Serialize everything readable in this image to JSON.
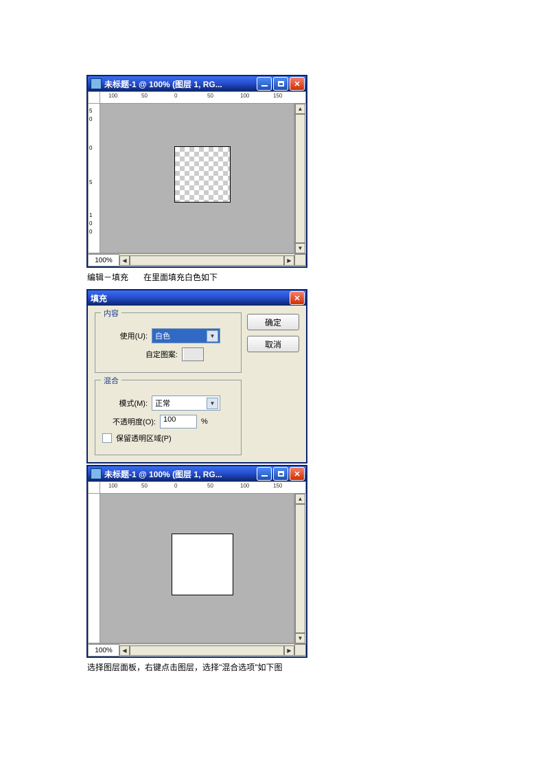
{
  "canvas1": {
    "title": "未标题-1 @ 100% (图层 1, RG...",
    "zoom": "100%",
    "ruler_h": [
      "100",
      "50",
      "0",
      "50",
      "100",
      "150"
    ],
    "ruler_v": [
      "5",
      "0",
      "0",
      "5",
      "1",
      "0",
      "0"
    ]
  },
  "caption1_a": "编辑－填充",
  "caption1_b": "在里面填充白色如下",
  "dialog": {
    "title": "填充",
    "group_content": "内容",
    "use_label": "使用(U):",
    "use_value": "白色",
    "pattern_label": "自定图案:",
    "group_blend": "混合",
    "mode_label": "模式(M):",
    "mode_value": "正常",
    "opacity_label": "不透明度(O):",
    "opacity_value": "100",
    "opacity_unit": "%",
    "preserve_label": "保留透明区域(P)",
    "ok": "确定",
    "cancel": "取消"
  },
  "canvas2": {
    "title": "未标题-1 @ 100% (图层 1, RG...",
    "zoom": "100%",
    "ruler_h": [
      "100",
      "50",
      "0",
      "50",
      "100",
      "150"
    ]
  },
  "caption2": "选择图层面板，右键点击图层，选择\"混合选项\"如下图"
}
